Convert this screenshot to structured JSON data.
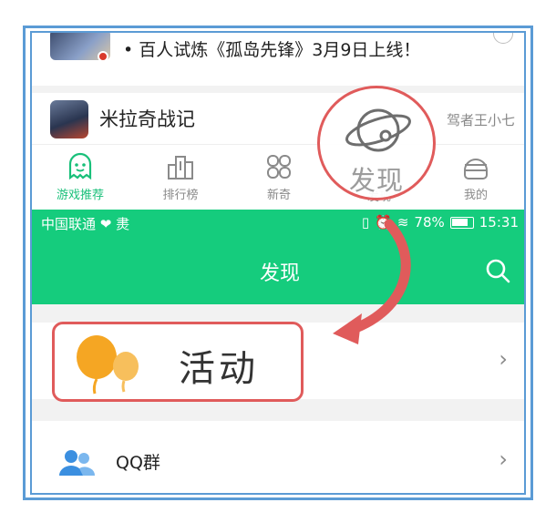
{
  "notice": {
    "text": "• 百人试炼《孤岛先锋》3月9日上线！"
  },
  "game": {
    "title": "米拉奇战记",
    "extra": "驾者王小七"
  },
  "tabs": [
    {
      "label": "游戏推荐",
      "icon": "ghost-icon",
      "active": true
    },
    {
      "label": "排行榜",
      "icon": "ranking-icon",
      "active": false
    },
    {
      "label": "新奇",
      "icon": "grid-icon",
      "active": false
    },
    {
      "label": "发现",
      "icon": "planet-icon",
      "active": false
    },
    {
      "label": "我的",
      "icon": "profile-icon",
      "active": false
    }
  ],
  "zoom": {
    "label": "发现",
    "icon": "planet-icon"
  },
  "statusbar": {
    "carrier": "中国联通 ❤ 㶳",
    "battery": "78%",
    "time": "15:31"
  },
  "titlebar": {
    "title": "发现"
  },
  "list": [
    {
      "label": "活动",
      "icon": "balloon-icon"
    },
    {
      "label": "QQ群",
      "icon": "group-icon"
    }
  ],
  "colors": {
    "accent_green": "#15cc7d",
    "highlight_red": "#e05b5b",
    "frame_blue": "#5b9bd5",
    "balloon_orange": "#f5a623"
  }
}
